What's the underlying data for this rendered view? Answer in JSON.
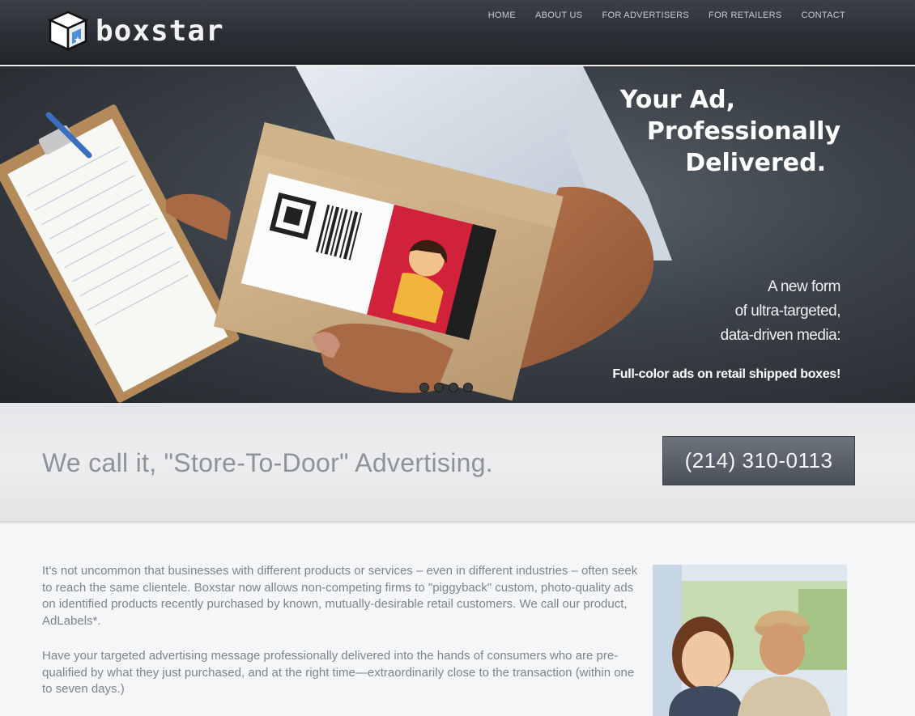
{
  "brand": {
    "name": "boxstar"
  },
  "nav": {
    "items": [
      {
        "label": "HOME"
      },
      {
        "label": "ABOUT US"
      },
      {
        "label": "FOR ADVERTISERS"
      },
      {
        "label": "FOR RETAILERS"
      },
      {
        "label": "CONTACT"
      }
    ]
  },
  "hero": {
    "headline": [
      "Your Ad,",
      "Professionally",
      "Delivered."
    ],
    "sub": [
      "A new form",
      "of ultra-targeted,",
      "data-driven media:"
    ],
    "tag": "Full-color ads on retail shipped boxes!",
    "slide_count": 4
  },
  "banner": {
    "tagline": "We call it, \"Store-To-Door\" Advertising.",
    "phone": "(214) 310-0113"
  },
  "content": {
    "paragraph1": "It's not uncommon that businesses with different products or services – even in different industries – often seek to reach the same clientele. Boxstar now allows non-competing firms to \"piggyback\" custom, photo-quality ads on identified products recently purchased by known, mutually-desirable retail customers. We call our product, AdLabels*.",
    "paragraph2": "Have your targeted advertising message professionally delivered into the hands of consumers who are pre-qualified by what they just purchased, and at the right time—extraordinarily close to the transaction (within one to seven days.)"
  },
  "colors": {
    "header": "#2b2f35",
    "hero_bg": "#3b4148",
    "banner_bg": "#ededee",
    "phone_button": "#5a6068",
    "tagline_text": "#8c939b",
    "body_text": "#7d848c"
  }
}
